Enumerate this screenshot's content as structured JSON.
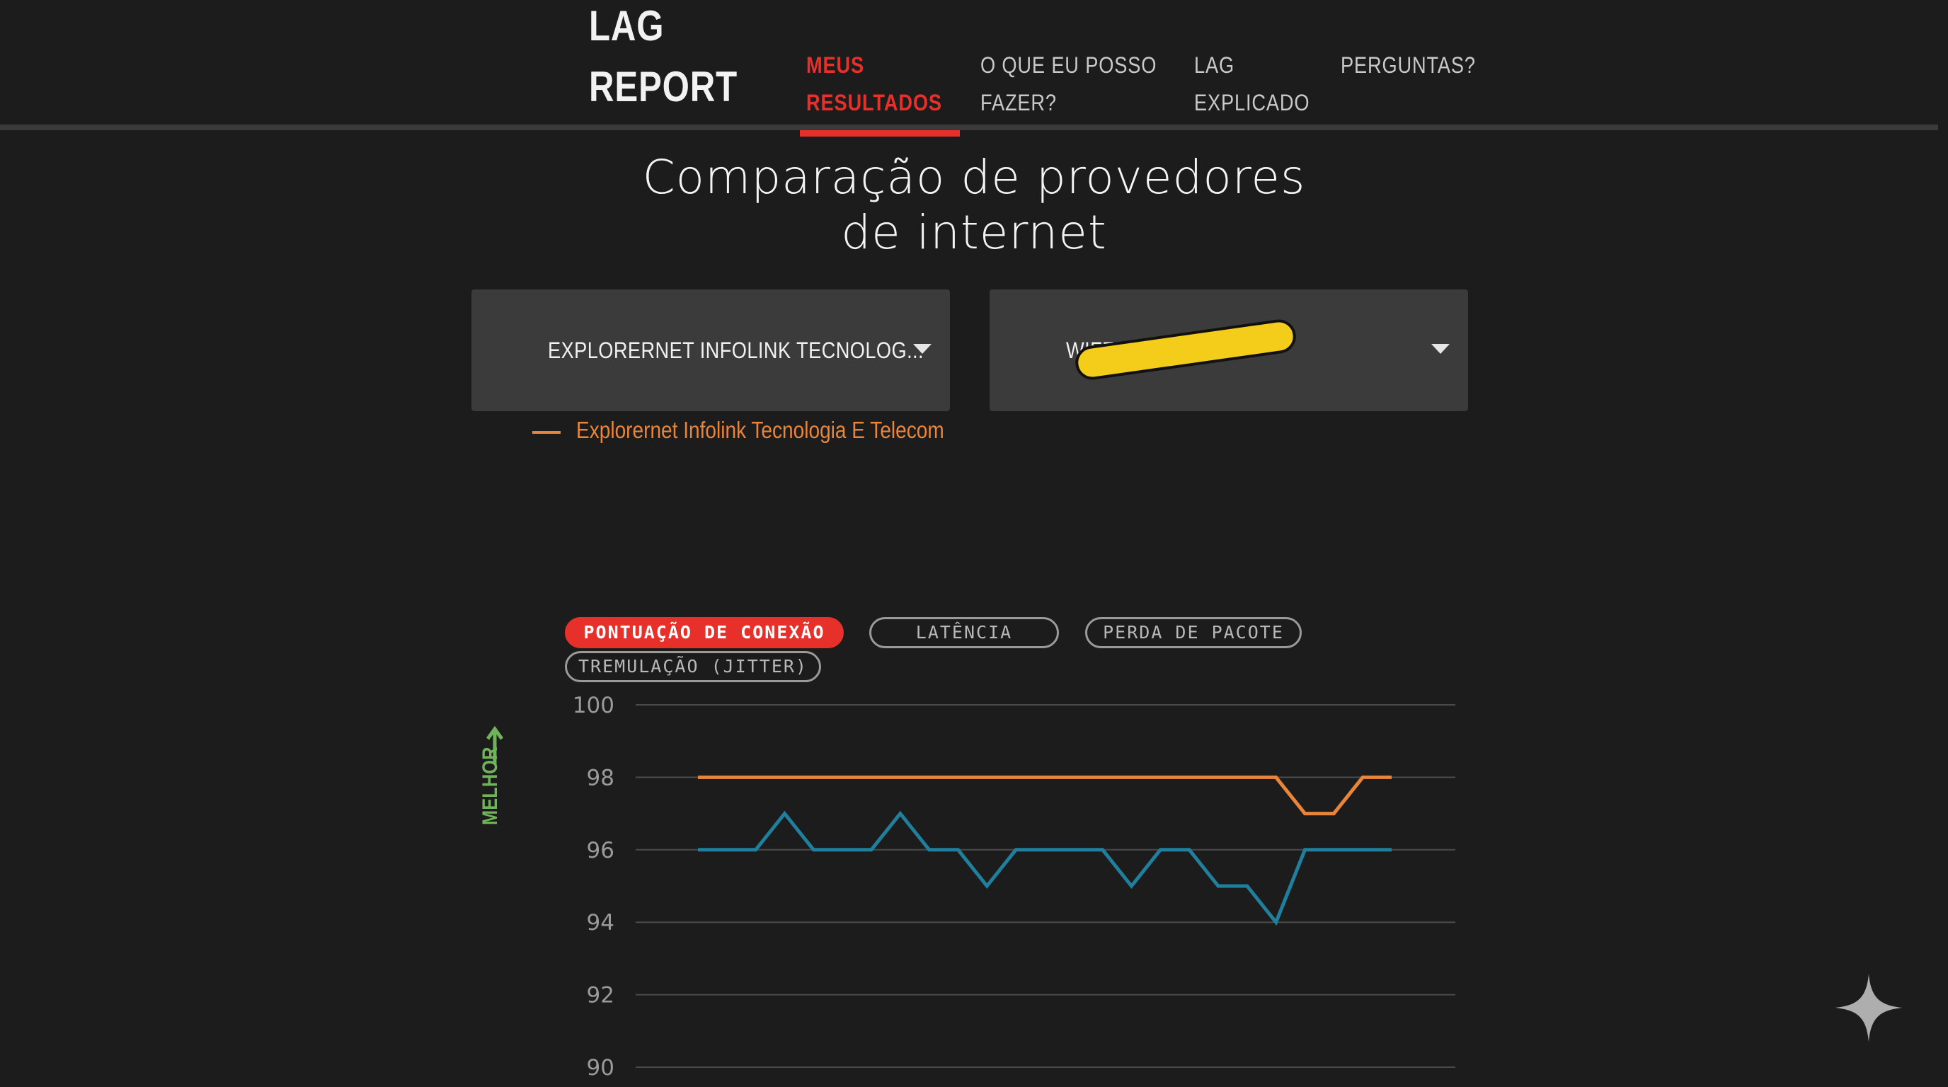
{
  "header": {
    "logo_line1": "LAG",
    "logo_line2": "REPORT",
    "nav": [
      {
        "line1": "MEUS",
        "line2": "RESULTADOS",
        "active": true
      },
      {
        "line1": "O QUE EU POSSO",
        "line2": "FAZER?",
        "active": false
      },
      {
        "line1": "LAG",
        "line2": "EXPLICADO",
        "active": false
      },
      {
        "line1": "PERGUNTAS?",
        "line2": "",
        "active": false
      }
    ]
  },
  "page": {
    "title_line1": "Comparação de provedores",
    "title_line2": "de internet"
  },
  "provider_select_1": {
    "value": "EXPLORERNET INFOLINK TECNOLOG..."
  },
  "provider_select_2": {
    "value": "WIFF TE... ...D)"
  },
  "legend": {
    "label": "Explorernet Infolink Tecnologia E Telecom",
    "color": "#e8853a"
  },
  "metric_tabs": [
    {
      "label": "PONTUAÇÃO DE CONEXÃO",
      "active": true
    },
    {
      "label": "LATÊNCIA",
      "active": false
    },
    {
      "label": "PERDA DE PACOTE",
      "active": false
    },
    {
      "label": "TREMULAÇÃO (JITTER)",
      "active": false
    }
  ],
  "axis_hint": {
    "label": "MELHOR",
    "color": "#6fb35a"
  },
  "colors": {
    "accent": "#e8302a",
    "background": "#1c1c1c",
    "series_1": "#e8853a",
    "series_2": "#1f7f9c"
  },
  "chart_data": {
    "type": "line",
    "ylim": [
      90,
      100
    ],
    "yticks": [
      "100",
      "98",
      "96",
      "94",
      "92",
      "90"
    ],
    "x": [
      0,
      1,
      2,
      3,
      4,
      5,
      6,
      7,
      8,
      9,
      10,
      11,
      12,
      13,
      14,
      15,
      16,
      17,
      18,
      19,
      20,
      21,
      22,
      23,
      24
    ],
    "series": [
      {
        "name": "Explorernet Infolink Tecnologia E Telecom",
        "color": "#e8853a",
        "values": [
          98,
          98,
          98,
          98,
          98,
          98,
          98,
          98,
          98,
          98,
          98,
          98,
          98,
          98,
          98,
          98,
          98,
          98,
          98,
          98,
          98,
          97,
          97,
          98,
          98
        ]
      },
      {
        "color": "#1f7f9c",
        "values": [
          96,
          96,
          96,
          97,
          96,
          96,
          96,
          97,
          96,
          96,
          95,
          96,
          96,
          96,
          96,
          95,
          96,
          96,
          95,
          95,
          94,
          96,
          96,
          96,
          96
        ]
      }
    ]
  }
}
